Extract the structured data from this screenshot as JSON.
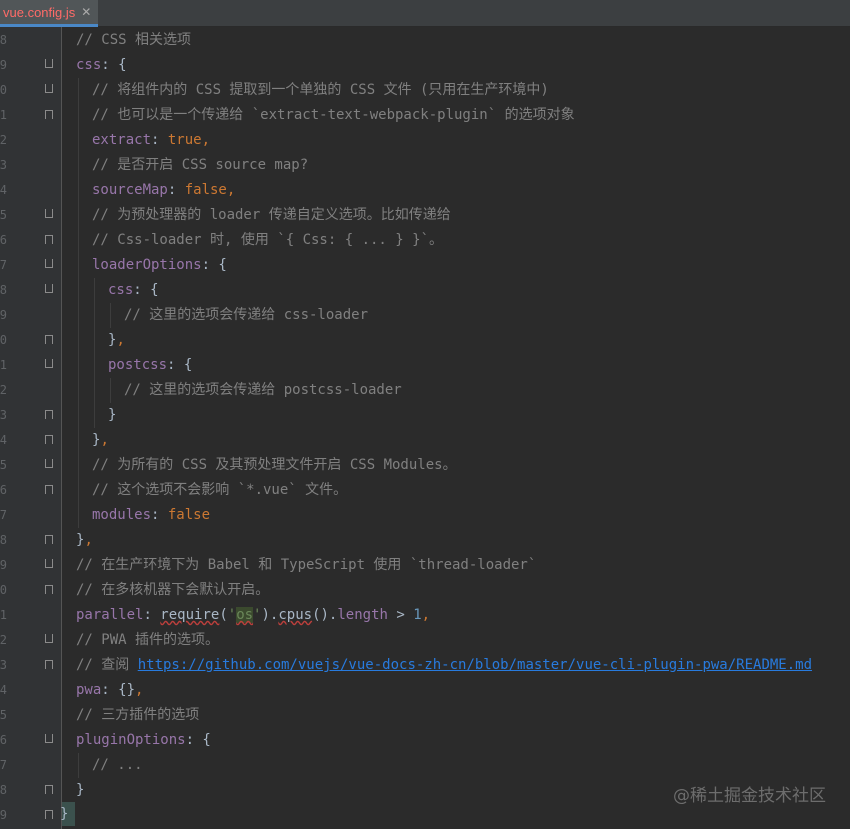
{
  "tab": {
    "label": "vue.config.js",
    "close": "✕"
  },
  "line_numbers": [
    "8",
    "9",
    "0",
    "1",
    "2",
    "3",
    "4",
    "5",
    "6",
    "7",
    "8",
    "9",
    "0",
    "1",
    "2",
    "3",
    "4",
    "5",
    "6",
    "7",
    "8",
    "9",
    "0",
    "1",
    "2",
    "3",
    "4",
    "5",
    "6",
    "7",
    "8",
    "9"
  ],
  "code": {
    "l1": "// CSS 相关选项",
    "l2_key": "css",
    "l2_rest": ": {",
    "l3": "// 将组件内的 CSS 提取到一个单独的 CSS 文件 (只用在生产环境中)",
    "l4": "// 也可以是一个传递给 `extract-text-webpack-plugin` 的选项对象",
    "l5_key": "extract",
    "l5_colon": ": ",
    "l5_val": "true,",
    "l6": "// 是否开启 CSS source map?",
    "l7_key": "sourceMap",
    "l7_colon": ": ",
    "l7_val": "false,",
    "l8": "// 为预处理器的 loader 传递自定义选项。比如传递给",
    "l9": "// Css-loader 时, 使用 `{ Css: { ... } }`。",
    "l10_key": "loaderOptions",
    "l10_rest": ": {",
    "l11_key": "css",
    "l11_rest": ": {",
    "l12": "// 这里的选项会传递给 css-loader",
    "l13_brace": "}",
    "l13_comma": ",",
    "l14_key": "postcss",
    "l14_rest": ": {",
    "l15": "// 这里的选项会传递给 postcss-loader",
    "l16": "}",
    "l17_brace": "}",
    "l17_comma": ",",
    "l18": "// 为所有的 CSS 及其预处理文件开启 CSS Modules。",
    "l19": "// 这个选项不会影响 `*.vue` 文件。",
    "l20_key": "modules",
    "l20_colon": ": ",
    "l20_val": "false",
    "l21_brace": "}",
    "l21_comma": ",",
    "l22": "// 在生产环境下为 Babel 和 TypeScript 使用 `thread-loader`",
    "l23": "// 在多核机器下会默认开启。",
    "l24_key": "parallel",
    "l24_colon": ": ",
    "l24_fn": "require",
    "l24_open": "(",
    "l24_q1": "'",
    "l24_str": "os",
    "l24_q2": "'",
    "l24_close": ").",
    "l24_cpus": "cpus",
    "l24_mid": "().",
    "l24_len": "length",
    "l24_op": " > ",
    "l24_num": "1",
    "l24_comma": ",",
    "l25": "// PWA 插件的选项。",
    "l26_pre": "// 查阅 ",
    "l26_url": "https://github.com/vuejs/vue-docs-zh-cn/blob/master/vue-cli-plugin-pwa/README.md",
    "l27_key": "pwa",
    "l27_colon": ": ",
    "l27_val": "{}",
    "l27_comma": ",",
    "l28": "// 三方插件的选项",
    "l29_key": "pluginOptions",
    "l29_rest": ": {",
    "l30": "// ...",
    "l31": "}",
    "l32": "}"
  },
  "watermark": "@稀土掘金技术社区",
  "colors": {
    "background": "#2b2b2b",
    "comment": "#808080",
    "property": "#9876aa",
    "keyword": "#cc7832",
    "number": "#6897bb",
    "string": "#6a8759",
    "link": "#287bde"
  }
}
